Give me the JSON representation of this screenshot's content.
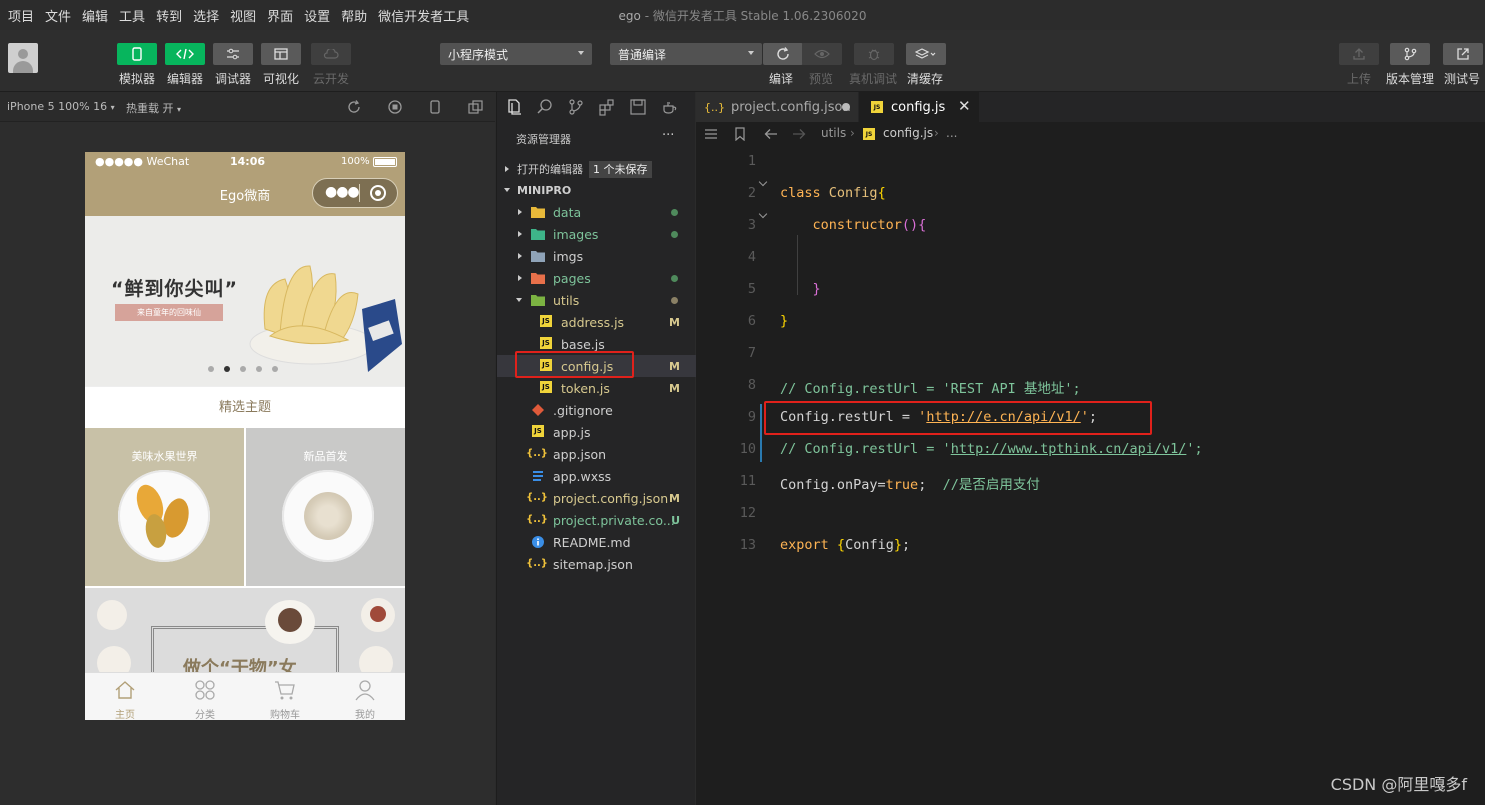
{
  "menu": {
    "items": [
      "项目",
      "文件",
      "编辑",
      "工具",
      "转到",
      "选择",
      "视图",
      "界面",
      "设置",
      "帮助",
      "微信开发者工具"
    ],
    "app_name": "ego",
    "app_suffix": " - 微信开发者工具 Stable 1.06.2306020"
  },
  "toolbar": {
    "simulator": "模拟器",
    "editor": "编辑器",
    "debugger": "调试器",
    "visual": "可视化",
    "cloud": "云开发",
    "mode_select": "小程序模式",
    "compile_select": "普通编译",
    "compile": "编译",
    "preview": "预览",
    "real_debug": "真机调试",
    "clear_cache": "清缓存",
    "upload": "上传",
    "version": "版本管理",
    "test": "测试号"
  },
  "simulator": {
    "device": "iPhone 5 100% 16",
    "hot_reload": "热重载 开",
    "status_carrier": "●●●●● WeChat",
    "status_time": "14:06",
    "status_battery": "100%",
    "nav_title": "Ego微商",
    "banner_slogan": "“鲜到你尖叫”",
    "banner_sub": "来自童年的回味仙",
    "section_title": "精选主题",
    "theme1": "美味水果世界",
    "theme2": "新品首发",
    "promo_text": "做个“干物”女",
    "tabs": [
      "主页",
      "分类",
      "购物车",
      "我的"
    ],
    "active_tab": 0
  },
  "explorer": {
    "title": "资源管理器",
    "more": "···",
    "open_editors": "打开的编辑器",
    "unsaved": "1 个未保存",
    "project": "MINIPRO",
    "items": [
      {
        "name": "data",
        "type": "folder",
        "color": "#e8b93a",
        "badge": "dot",
        "badge_color": "#4f8a5c",
        "label_color": "#7ec49b",
        "indent": 1
      },
      {
        "name": "images",
        "type": "folder",
        "color": "#3eb489",
        "badge": "dot",
        "badge_color": "#4f8a5c",
        "label_color": "#7ec49b",
        "indent": 1
      },
      {
        "name": "imgs",
        "type": "folder",
        "color": "#8fa3b8",
        "badge": "",
        "badge_color": "",
        "label_color": "#cfcfcf",
        "indent": 1
      },
      {
        "name": "pages",
        "type": "folder",
        "color": "#e8704a",
        "badge": "dot",
        "badge_color": "#4f8a5c",
        "label_color": "#7ec49b",
        "indent": 1
      },
      {
        "name": "utils",
        "type": "folder-open",
        "color": "#7cb342",
        "badge": "dot",
        "badge_color": "#8a8065",
        "label_color": "#d7c98f",
        "indent": 1
      },
      {
        "name": "address.js",
        "type": "js",
        "color": "#f0d43a",
        "badge": "M",
        "badge_color": "#d7c98f",
        "label_color": "#d7c98f",
        "indent": 2
      },
      {
        "name": "base.js",
        "type": "js",
        "color": "#f0d43a",
        "badge": "",
        "badge_color": "",
        "label_color": "#cfcfcf",
        "indent": 2
      },
      {
        "name": "config.js",
        "type": "js",
        "color": "#f0d43a",
        "badge": "M",
        "badge_color": "#d7c98f",
        "label_color": "#d7c98f",
        "indent": 2
      },
      {
        "name": "token.js",
        "type": "js",
        "color": "#f0d43a",
        "badge": "M",
        "badge_color": "#d7c98f",
        "label_color": "#d7c98f",
        "indent": 2
      },
      {
        "name": ".gitignore",
        "type": "git",
        "color": "#e05a3a",
        "badge": "",
        "badge_color": "",
        "label_color": "#cfcfcf",
        "indent": 1
      },
      {
        "name": "app.js",
        "type": "js",
        "color": "#f0d43a",
        "badge": "",
        "badge_color": "",
        "label_color": "#cfcfcf",
        "indent": 1
      },
      {
        "name": "app.json",
        "type": "json",
        "color": "#f0c23a",
        "badge": "",
        "badge_color": "",
        "label_color": "#cfcfcf",
        "indent": 1
      },
      {
        "name": "app.wxss",
        "type": "css",
        "color": "#3a8ee6",
        "badge": "",
        "badge_color": "",
        "label_color": "#cfcfcf",
        "indent": 1
      },
      {
        "name": "project.config.json",
        "type": "json",
        "color": "#f0c23a",
        "badge": "M",
        "badge_color": "#d7c98f",
        "label_color": "#d7c98f",
        "indent": 1
      },
      {
        "name": "project.private.co...",
        "type": "json",
        "color": "#f0c23a",
        "badge": "U",
        "badge_color": "#7ec49b",
        "label_color": "#7ec49b",
        "indent": 1
      },
      {
        "name": "README.md",
        "type": "info",
        "color": "#3a8ee6",
        "badge": "",
        "badge_color": "",
        "label_color": "#cfcfcf",
        "indent": 1
      },
      {
        "name": "sitemap.json",
        "type": "json",
        "color": "#f0c23a",
        "badge": "",
        "badge_color": "",
        "label_color": "#cfcfcf",
        "indent": 1
      }
    ],
    "selected_index": 7
  },
  "editor": {
    "tab1": "project.config.json",
    "tab2": "config.js",
    "crumb_folder": "utils",
    "crumb_file": "config.js",
    "crumb_more": "...",
    "lines": [
      {
        "n": "1",
        "html": ""
      },
      {
        "n": "2",
        "html": "<span class='kw'>class</span> <span class='cls'>Config</span><span style='color:#ffd700'>{</span>"
      },
      {
        "n": "3",
        "html": "    <span class='kw'>constructor</span><span style='color:#da70d6'>(){</span>"
      },
      {
        "n": "4",
        "html": ""
      },
      {
        "n": "5",
        "html": "    <span style='color:#da70d6'>}</span>"
      },
      {
        "n": "6",
        "html": "<span style='color:#ffd700'>}</span>"
      },
      {
        "n": "7",
        "html": ""
      },
      {
        "n": "8",
        "html": "<span class='cm'>// Config.restUrl = 'REST API 基地址';</span>"
      },
      {
        "n": "9",
        "html": "Config.restUrl = <span class='str'>'<span class='url'>http://e.cn/api/v1/</span>'</span>;"
      },
      {
        "n": "10",
        "html": "<span class='cm'>// Config.restUrl = '<span class='url'>http://www.tpthink.cn/api/v1/</span>';</span>"
      },
      {
        "n": "11",
        "html": "Config.onPay=<span class='kw'>true</span>;  <span class='cm'>//是否启用支付</span>"
      },
      {
        "n": "12",
        "html": ""
      },
      {
        "n": "13",
        "html": "<span class='kw'>export</span> <span style='color:#ffd700'>{</span>Config<span style='color:#ffd700'>}</span>;"
      }
    ]
  },
  "watermark": "CSDN @阿里嘎多f"
}
